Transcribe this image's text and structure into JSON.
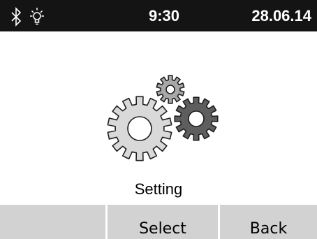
{
  "status_bar": {
    "time": "9:30",
    "date": "28.06.14",
    "icons": [
      "bluetooth-icon",
      "light-bulb-icon"
    ]
  },
  "screen": {
    "title": "Setting",
    "icon": "settings-gears-icon"
  },
  "softkeys": {
    "left": "",
    "middle": "Select",
    "right": "Back"
  },
  "colors": {
    "status_bar_bg": "#141414",
    "softkey_bg": "#d2d2d2",
    "gear_large": "#d9d9d9",
    "gear_medium": "#5e5e5e",
    "gear_small": "#a8a8a8"
  }
}
